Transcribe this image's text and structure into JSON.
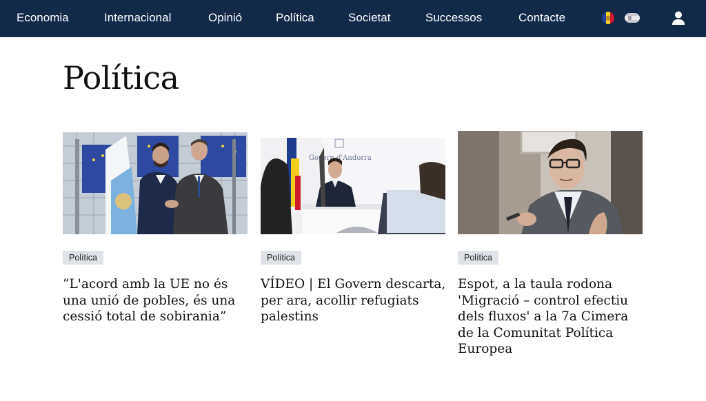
{
  "nav": {
    "items": [
      {
        "label": "Economia"
      },
      {
        "label": "Internacional"
      },
      {
        "label": "Opinió"
      },
      {
        "label": "Política"
      },
      {
        "label": "Societat"
      },
      {
        "label": "Successos"
      },
      {
        "label": "Contacte"
      }
    ],
    "flags": [
      "andorra-flag-icon",
      "spanish-flag-icon"
    ],
    "user_icon": "user-icon",
    "bg_color": "#12294a"
  },
  "page": {
    "title": "Política"
  },
  "articles": [
    {
      "tag": "Política",
      "headline": "“L'acord amb la UE no és una unió de pobles, és una cessió total de sobirania”"
    },
    {
      "tag": "Política",
      "headline": "VÍDEO | El Govern descarta, per ara, acollir refugiats palestins"
    },
    {
      "tag": "Política",
      "headline": "Espot, a la taula rodona 'Migració – control efectiu dels fluxos' a la 7a Cimera de la Comunitat Política Europea"
    }
  ],
  "images": {
    "img1_caption": "Govern d'Andorra"
  }
}
